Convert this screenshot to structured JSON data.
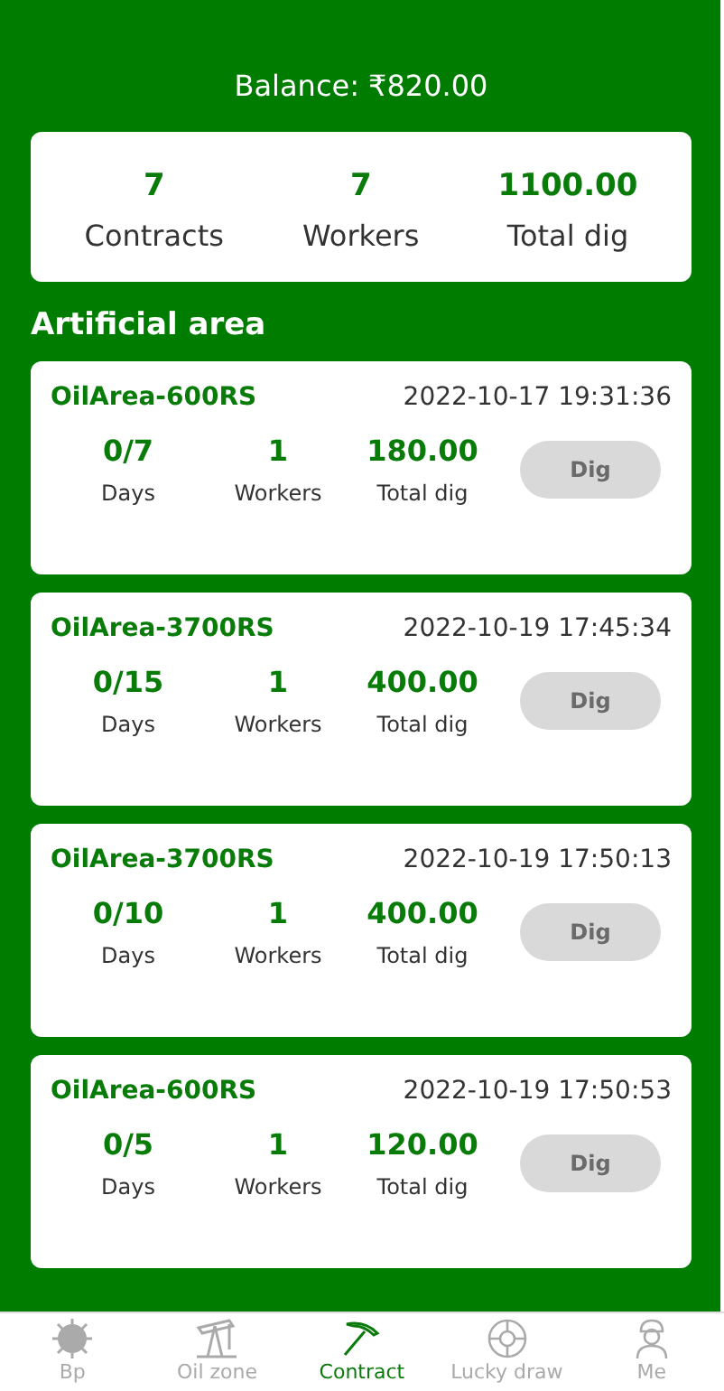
{
  "balance": "Balance: ₹820.00",
  "summary": [
    {
      "value": "7",
      "label": "Contracts"
    },
    {
      "value": "7",
      "label": "Workers"
    },
    {
      "value": "1100.00",
      "label": "Total dig"
    }
  ],
  "section_title": "Artificial area",
  "contracts": [
    {
      "name": "OilArea-600RS",
      "time": "2022-10-17 19:31:36",
      "days": "0/7",
      "days_label": "Days",
      "workers": "1",
      "workers_label": "Workers",
      "total": "180.00",
      "total_label": "Total dig",
      "button": "Dig",
      "disabled": true
    },
    {
      "name": "OilArea-3700RS",
      "time": "2022-10-19 17:45:34",
      "days": "0/15",
      "days_label": "Days",
      "workers": "1",
      "workers_label": "Workers",
      "total": "400.00",
      "total_label": "Total dig",
      "button": "Dig",
      "disabled": true
    },
    {
      "name": "OilArea-3700RS",
      "time": "2022-10-19 17:50:13",
      "days": "0/10",
      "days_label": "Days",
      "workers": "1",
      "workers_label": "Workers",
      "total": "400.00",
      "total_label": "Total dig",
      "button": "Dig",
      "disabled": true
    },
    {
      "name": "OilArea-600RS",
      "time": "2022-10-19 17:50:53",
      "days": "0/5",
      "days_label": "Days",
      "workers": "1",
      "workers_label": "Workers",
      "total": "120.00",
      "total_label": "Total dig",
      "button": "Dig",
      "disabled": true
    }
  ],
  "nav": [
    {
      "label": "Bp",
      "kind": "sun",
      "selected": false
    },
    {
      "label": "Oil zone",
      "kind": "pump",
      "selected": false
    },
    {
      "label": "Contract",
      "kind": "pickaxe",
      "selected": true
    },
    {
      "label": "Lucky draw",
      "kind": "wheel",
      "selected": false
    },
    {
      "label": "Me",
      "kind": "worker",
      "selected": false
    }
  ]
}
